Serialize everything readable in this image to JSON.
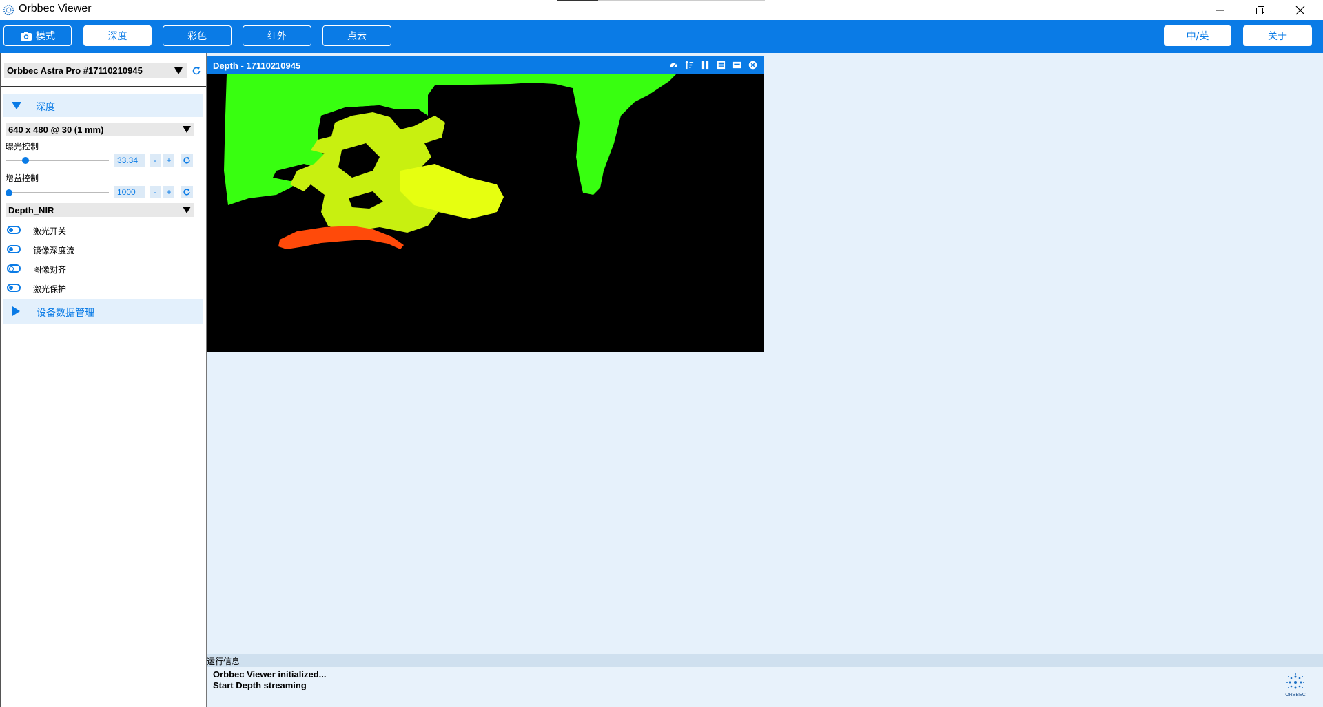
{
  "window": {
    "title": "Orbbec Viewer",
    "icons": [
      "orbbec-logo-icon",
      "minimize-icon",
      "restore-icon",
      "close-icon"
    ]
  },
  "toolbar": {
    "mode_label": "模式",
    "tabs": [
      "深度",
      "彩色",
      "红外",
      "点云"
    ],
    "active_tab": "深度",
    "lang_label": "中/英",
    "about_label": "关于",
    "accent_color": "#0a7be6"
  },
  "sidebar": {
    "device": "Orbbec Astra Pro #17110210945",
    "depth_section": "深度",
    "resolution": "640 x 480 @ 30 (1 mm)",
    "exposure": {
      "label": "曝光控制",
      "value": "33.34",
      "level": 0.19
    },
    "gain": {
      "label": "增益控制",
      "value": "1000",
      "level": 0.0
    },
    "minus": "-",
    "plus": "+",
    "stream_mode": "Depth_NIR",
    "toggles": [
      {
        "label": "激光开关",
        "on": true
      },
      {
        "label": "镜像深度流",
        "on": true
      },
      {
        "label": "图像对齐",
        "on": false
      },
      {
        "label": "激光保护",
        "on": true
      }
    ],
    "device_data_section": "设备数据管理"
  },
  "depth_window": {
    "title": "Depth - 17110210945",
    "icons": [
      "speed-icon",
      "sort-icon",
      "pause-icon",
      "save-icon",
      "minimize-window-icon",
      "close-window-icon"
    ],
    "colors": {
      "near": "#ff4a0a",
      "mid": "#e6ff10",
      "far": "#38ff10"
    }
  },
  "log": {
    "header": "运行信息",
    "lines": [
      "Orbbec Viewer initialized...",
      "Start Depth streaming"
    ],
    "brand": "ORBBEC"
  }
}
